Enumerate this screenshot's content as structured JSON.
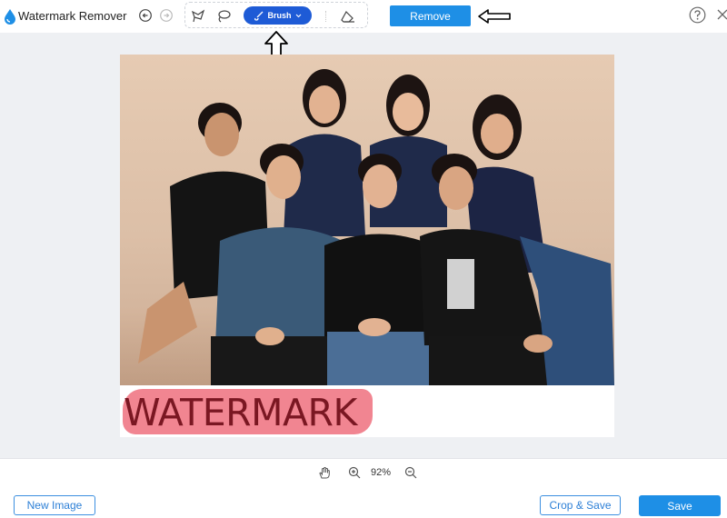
{
  "app": {
    "title": "Watermark Remover"
  },
  "toolbar": {
    "brush_label": "Brush",
    "remove_label": "Remove",
    "icons": [
      "logo-icon",
      "undo-icon",
      "redo-icon",
      "polygon-lasso-icon",
      "lasso-icon",
      "brush-icon",
      "chevron-down-icon",
      "eraser-icon",
      "help-icon",
      "close-icon"
    ]
  },
  "annotations": [
    "arrow-right-icon",
    "arrow-up-icon"
  ],
  "canvas": {
    "watermark_text": "WATERMARK",
    "photo": "group-photo"
  },
  "zoom": {
    "value": "92%"
  },
  "footer": {
    "new_image_label": "New Image",
    "crop_save_label": "Crop & Save",
    "save_label": "Save"
  },
  "colors": {
    "accent": "#1e8fe6",
    "brush_active": "#1e5bd6",
    "highlight": "#f07b88",
    "background": "#eef0f3"
  }
}
